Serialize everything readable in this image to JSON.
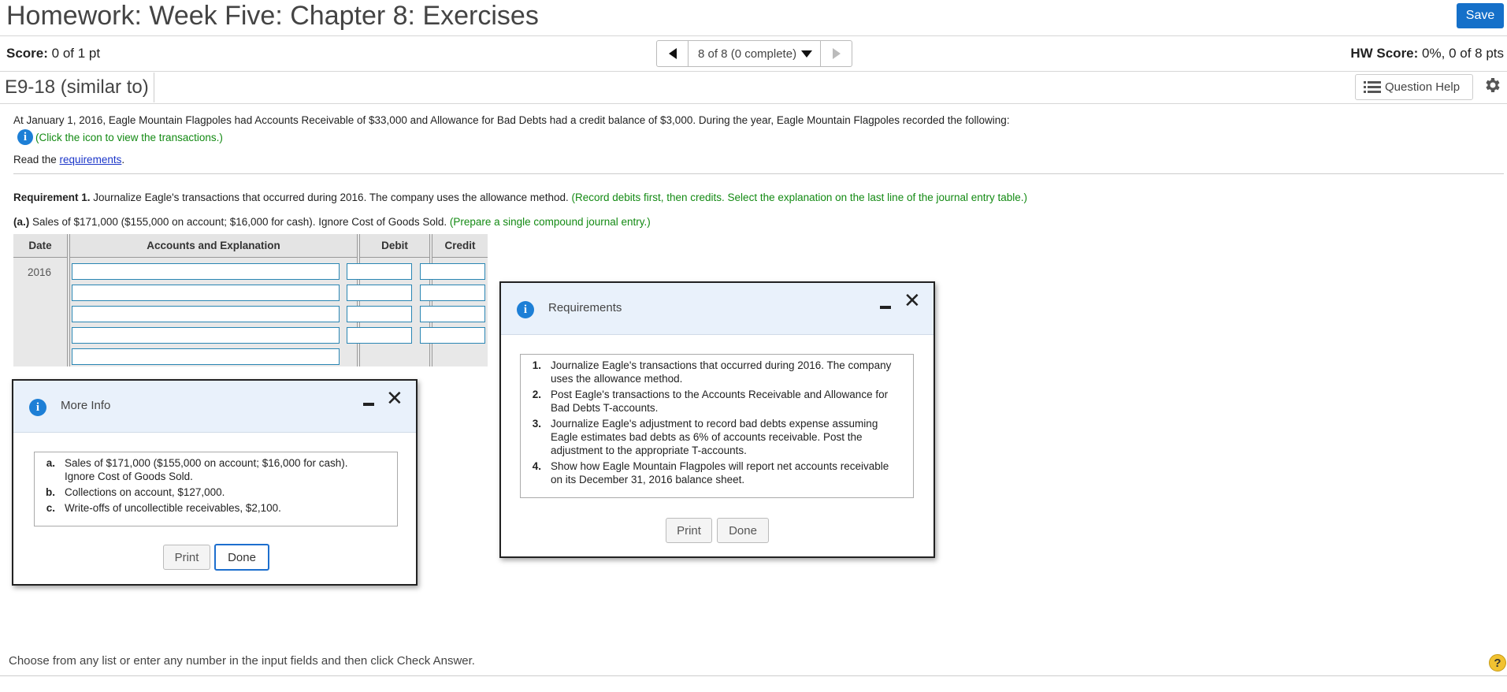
{
  "header": {
    "title": "Homework: Week Five: Chapter 8: Exercises",
    "save_label": "Save"
  },
  "scorebar": {
    "score_label": "Score:",
    "score_value": "0 of 1 pt",
    "nav_status": "8 of 8 (0 complete)",
    "hw_score_label": "HW Score:",
    "hw_score_value": "0%, 0 of 8 pts"
  },
  "question": {
    "id": "E9-18 (similar to)",
    "help_label": "Question Help",
    "intro": "At January 1, 2016, Eagle Mountain Flagpoles had Accounts Receivable of $33,000 and Allowance for Bad Debts had a credit balance of $3,000. During the year, Eagle Mountain Flagpoles recorded the following:",
    "click_icon_text": "(Click the icon to view the transactions.)",
    "read_prefix": "Read the ",
    "requirements_link": "requirements",
    "read_suffix": ".",
    "req1_bold": "Requirement 1.",
    "req1_text": " Journalize Eagle's transactions that occurred during 2016. The company uses the allowance method. ",
    "req1_green": "(Record debits first, then credits. Select the explanation on the last line of the journal entry table.)",
    "part_a_bold": "(a.)",
    "part_a_text": " Sales of $171,000 ($155,000 on account; $16,000 for cash). Ignore Cost of Goods Sold. ",
    "part_a_green": "(Prepare a single compound journal entry.)"
  },
  "journal": {
    "headers": [
      "Date",
      "Accounts and Explanation",
      "Debit",
      "Credit"
    ],
    "year": "2016"
  },
  "more_info": {
    "title": "More Info",
    "items": [
      {
        "label": "a.",
        "text": "Sales of $171,000 ($155,000 on account; $16,000 for cash). Ignore Cost of Goods Sold."
      },
      {
        "label": "b.",
        "text": "Collections on account, $127,000."
      },
      {
        "label": "c.",
        "text": "Write-offs of uncollectible receivables, $2,100."
      }
    ],
    "print_label": "Print",
    "done_label": "Done"
  },
  "requirements": {
    "title": "Requirements",
    "items": [
      {
        "label": "1.",
        "text": "Journalize Eagle's transactions that occurred during 2016. The company uses the allowance method."
      },
      {
        "label": "2.",
        "text": "Post Eagle's transactions to the Accounts Receivable and Allowance for Bad Debts T-accounts."
      },
      {
        "label": "3.",
        "text": "Journalize Eagle's adjustment to record bad debts expense assuming Eagle estimates bad debts as 6% of accounts receivable. Post the adjustment to the appropriate T-accounts."
      },
      {
        "label": "4.",
        "text": "Show how Eagle Mountain Flagpoles will report net accounts receivable on its December 31, 2016 balance sheet."
      }
    ],
    "print_label": "Print",
    "done_label": "Done"
  },
  "footer": {
    "instruction": "Choose from any list or enter any number in the input fields and then click Check Answer.",
    "help_glyph": "?"
  },
  "colors": {
    "accent_blue": "#1570c9",
    "green_text": "#138a13",
    "link": "#1a35c9",
    "info_icon": "#1d7fd6"
  },
  "icons": [
    "info-icon",
    "prev-arrow-icon",
    "next-arrow-icon",
    "dropdown-icon",
    "list-icon",
    "gear-icon",
    "minimize-icon",
    "close-icon",
    "help-icon"
  ]
}
